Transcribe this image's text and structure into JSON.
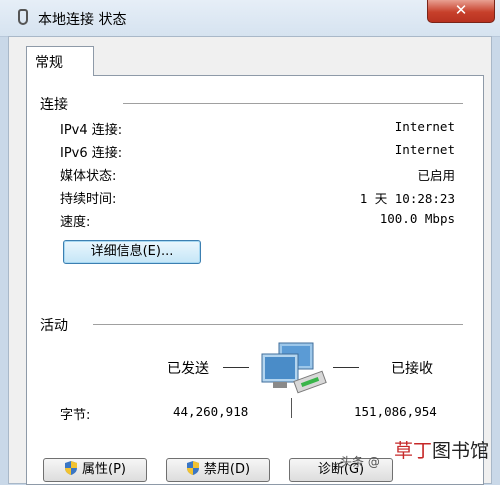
{
  "window": {
    "title": "本地连接 状态",
    "close_label": "✕"
  },
  "tab": {
    "label": "常规"
  },
  "connection": {
    "title": "连接",
    "rows": [
      {
        "label": "IPv4 连接:",
        "value": "Internet"
      },
      {
        "label": "IPv6 连接:",
        "value": "Internet"
      },
      {
        "label": "媒体状态:",
        "value": "已启用"
      },
      {
        "label": "持续时间:",
        "value": "1 天 10:28:23"
      },
      {
        "label": "速度:",
        "value": "100.0 Mbps"
      }
    ],
    "details_button": "详细信息(E)..."
  },
  "activity": {
    "title": "活动",
    "sent_label": "已发送",
    "received_label": "已接收",
    "bytes_label": "字节:",
    "bytes_sent": "44,260,918",
    "bytes_received": "151,086,954"
  },
  "buttons": {
    "properties": "属性(P)",
    "disable": "禁用(D)",
    "diagnose": "诊断(G)"
  },
  "watermark": "头条 @",
  "brand": {
    "accent": "草丁",
    "rest": "图书馆"
  },
  "colors": {
    "close": "#c7402b",
    "accent_button": "#3c7fb1"
  }
}
